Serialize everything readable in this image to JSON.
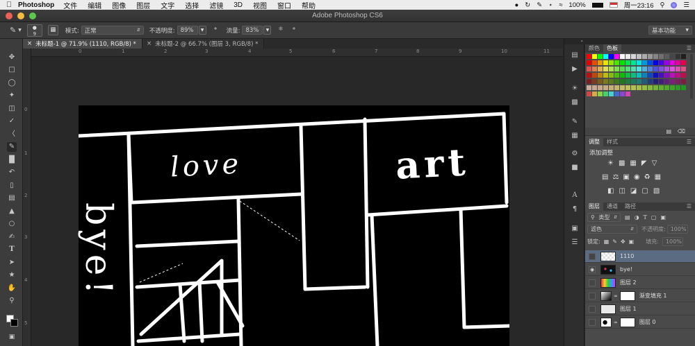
{
  "menubar": {
    "apple": "",
    "app_name": "Photoshop",
    "items": [
      "文件",
      "编辑",
      "图像",
      "图层",
      "文字",
      "选择",
      "滤镜",
      "3D",
      "视图",
      "窗口",
      "帮助"
    ],
    "battery": "100%",
    "clock": "周一23:16"
  },
  "window": {
    "title": "Adobe Photoshop CS6"
  },
  "options": {
    "brush_size": "9",
    "mode_label": "模式:",
    "mode_value": "正常",
    "opacity_label": "不透明度:",
    "opacity_value": "89%",
    "flow_label": "流量:",
    "flow_value": "83%",
    "workspace": "基本功能"
  },
  "documents": [
    {
      "label": "未标题-1 @ 71.9% (1110, RGB/8) *",
      "active": true
    },
    {
      "label": "未标题-2 @ 66.7% (图层 3, RGB/8) *",
      "active": false
    }
  ],
  "ruler_h": [
    "0",
    "1",
    "2",
    "3",
    "4",
    "5",
    "6",
    "7",
    "8",
    "9",
    "10",
    "11"
  ],
  "ruler_v": [
    "0",
    "1",
    "2",
    "3",
    "4",
    "5"
  ],
  "canvas_text": {
    "love": "love",
    "art": "art",
    "bye": "bye!"
  },
  "color_panel": {
    "tabs": [
      "颜色",
      "色板"
    ],
    "active_tab": 1
  },
  "adjust_panel": {
    "tabs": [
      "调整",
      "样式"
    ],
    "active_tab": 0,
    "title": "添加调整"
  },
  "layers_panel": {
    "tabs": [
      "图层",
      "通道",
      "路径"
    ],
    "active_tab": 0,
    "filter": "类型",
    "blend": "滤色",
    "opacity_label": "不透明度:",
    "opacity_value": "100%",
    "lock_label": "锁定:",
    "fill_label": "填充:",
    "fill_value": "100%",
    "layers": [
      {
        "name": "1110",
        "selected": true,
        "visible": false,
        "mask": false
      },
      {
        "name": "bye!",
        "selected": false,
        "visible": true,
        "mask": false
      },
      {
        "name": "图层 2",
        "selected": false,
        "visible": false,
        "mask": false
      },
      {
        "name": "渐变填充 1",
        "selected": false,
        "visible": false,
        "mask": true
      },
      {
        "name": "图层 1",
        "selected": false,
        "visible": false,
        "mask": false
      },
      {
        "name": "图层 0",
        "selected": false,
        "visible": false,
        "mask": true
      }
    ]
  },
  "colors": {
    "accent_selected": "#5b6b82",
    "panel_bg": "#4a4a4a",
    "canvas_bg": "#000000"
  }
}
